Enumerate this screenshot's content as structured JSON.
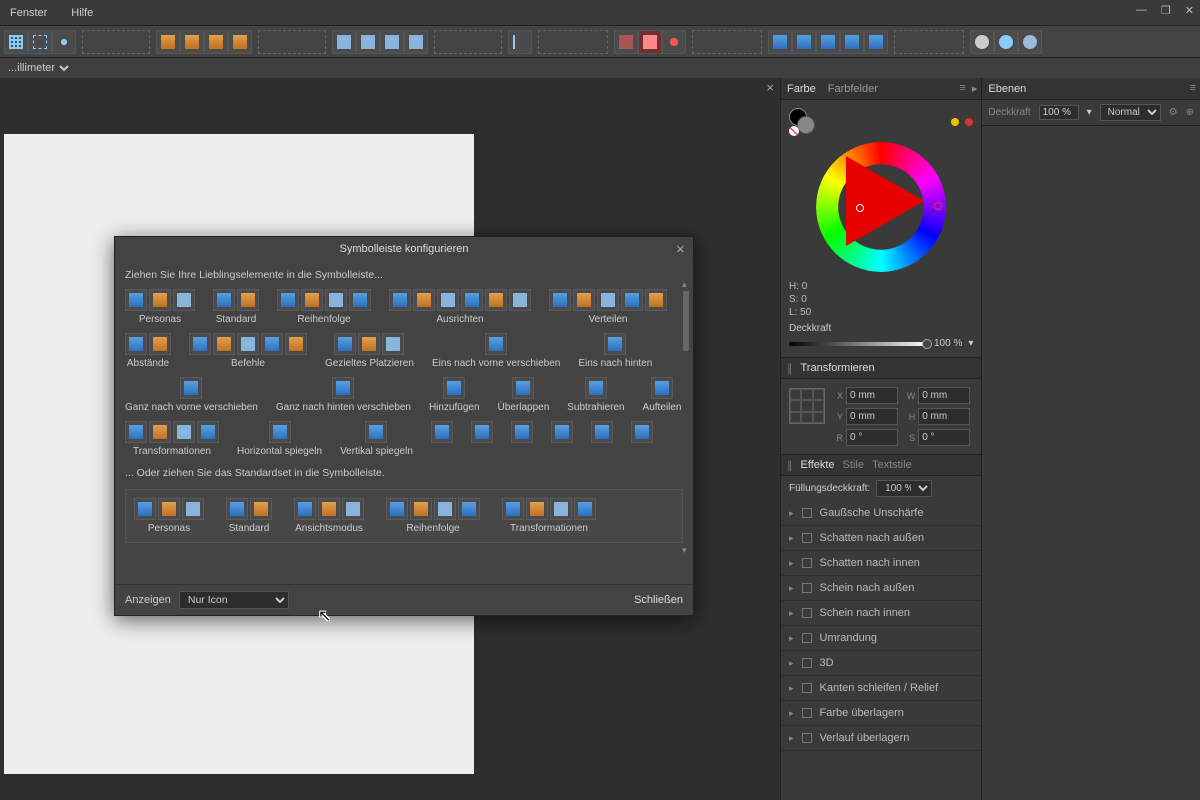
{
  "menu": {
    "window": "Fenster",
    "help": "Hilfe"
  },
  "units": {
    "selected": "...illimeter"
  },
  "panels": {
    "color_tab": "Farbe",
    "swatches_tab": "Farbfelder",
    "layers_tab": "Ebenen",
    "hsl": {
      "h_label": "H:",
      "h": "0",
      "s_label": "S:",
      "s": "0",
      "l_label": "L:",
      "l": "50"
    },
    "opacity_label": "Deckkraft",
    "opacity_value": "100 %",
    "transform_header": "Transformieren",
    "transform": {
      "x": "0 mm",
      "y": "0 mm",
      "w": "0 mm",
      "h": "0 mm",
      "r": "0 °",
      "s": "0 °"
    },
    "effects_tab": "Effekte",
    "styles_tab": "Stile",
    "textstyles_tab": "Textstile",
    "fill_opacity_label": "Füllungsdeckkraft:",
    "fill_opacity_value": "100 %",
    "effects": [
      "Gaußsche Unschärfe",
      "Schatten nach außen",
      "Schatten nach innen",
      "Schein nach außen",
      "Schein nach innen",
      "Umrandung",
      "3D",
      "Kanten schleifen / Relief",
      "Farbe überlagern",
      "Verlauf überlagern"
    ],
    "layers_opacity": "100 %",
    "layers_blend": "Normal",
    "layers_opacity_label": "Deckkraft"
  },
  "dialog": {
    "title": "Symbolleiste konfigurieren",
    "hint": "Ziehen Sie Ihre Lieblingselemente in die Symbolleiste...",
    "hint2": "... Oder ziehen Sie das Standardset in die Symbolleiste.",
    "groups_row1": [
      {
        "label": "Personas",
        "count": 3
      },
      {
        "label": "Standard",
        "count": 2
      },
      {
        "label": "Reihenfolge",
        "count": 4
      },
      {
        "label": "Ausrichten",
        "count": 6
      }
    ],
    "groups_row2": [
      {
        "label": "Verteilen",
        "count": 5
      },
      {
        "label": "Abstände",
        "count": 2
      },
      {
        "label": "Befehle",
        "count": 5
      },
      {
        "label": "Gezieltes Platzieren",
        "count": 3
      }
    ],
    "groups_row3": [
      {
        "label": "Eins nach vorne verschieben",
        "count": 1
      },
      {
        "label": "Eins nach hinten",
        "count": 1
      },
      {
        "label": "Ganz nach vorne verschieben",
        "count": 1
      },
      {
        "label": "Ganz nach hinten verschieben",
        "count": 1
      },
      {
        "label": "Hinzufügen",
        "count": 1
      }
    ],
    "groups_row4": [
      {
        "label": "Überlappen",
        "count": 1
      },
      {
        "label": "Subtrahieren",
        "count": 1
      },
      {
        "label": "Aufteilen",
        "count": 1
      },
      {
        "label": "Transformationen",
        "count": 4
      },
      {
        "label": "Horizontal spiegeln",
        "count": 1
      },
      {
        "label": "Vertikal spiegeln",
        "count": 1
      }
    ],
    "groups_row5": [
      {
        "label": "",
        "count": 1
      },
      {
        "label": "",
        "count": 1
      },
      {
        "label": "",
        "count": 1
      },
      {
        "label": "",
        "count": 1
      },
      {
        "label": "",
        "count": 1
      },
      {
        "label": "",
        "count": 1
      }
    ],
    "defaults": [
      {
        "label": "Personas",
        "count": 3
      },
      {
        "label": "Standard",
        "count": 2
      },
      {
        "label": "Ansichtsmodus",
        "count": 3
      },
      {
        "label": "Reihenfolge",
        "count": 4
      },
      {
        "label": "Transformationen",
        "count": 4
      }
    ],
    "show_label": "Anzeigen",
    "show_value": "Nur Icon",
    "close": "Schließen"
  }
}
